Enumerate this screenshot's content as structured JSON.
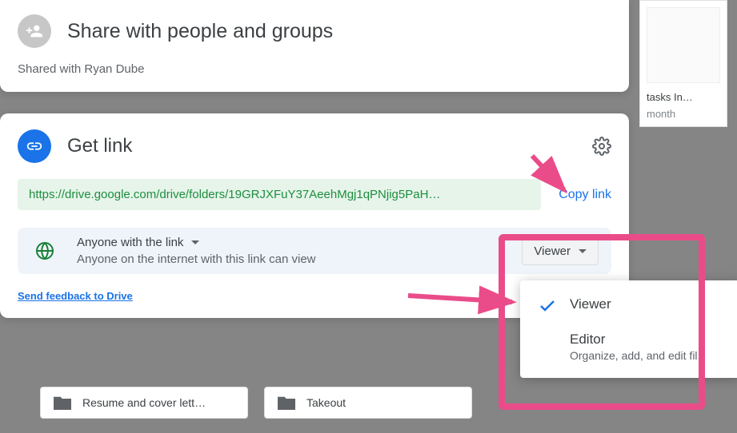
{
  "background": {
    "card_title": "tasks In…",
    "card_sub": "month",
    "folders": [
      "Resume and cover lett…",
      "Takeout"
    ]
  },
  "share": {
    "title": "Share with people and groups",
    "subtitle": "Shared with Ryan Dube"
  },
  "link": {
    "title": "Get link",
    "url": "https://drive.google.com/drive/folders/19GRJXFuY37AeehMgj1qPNjig5PaH…",
    "copy_label": "Copy link",
    "access_title": "Anyone with the link",
    "access_sub": "Anyone on the internet with this link can view",
    "role_selected": "Viewer",
    "feedback": "Send feedback to Drive"
  },
  "dropdown": {
    "options": [
      {
        "label": "Viewer",
        "sub": "",
        "selected": true
      },
      {
        "label": "Editor",
        "sub": "Organize, add, and edit fil",
        "selected": false
      }
    ]
  }
}
